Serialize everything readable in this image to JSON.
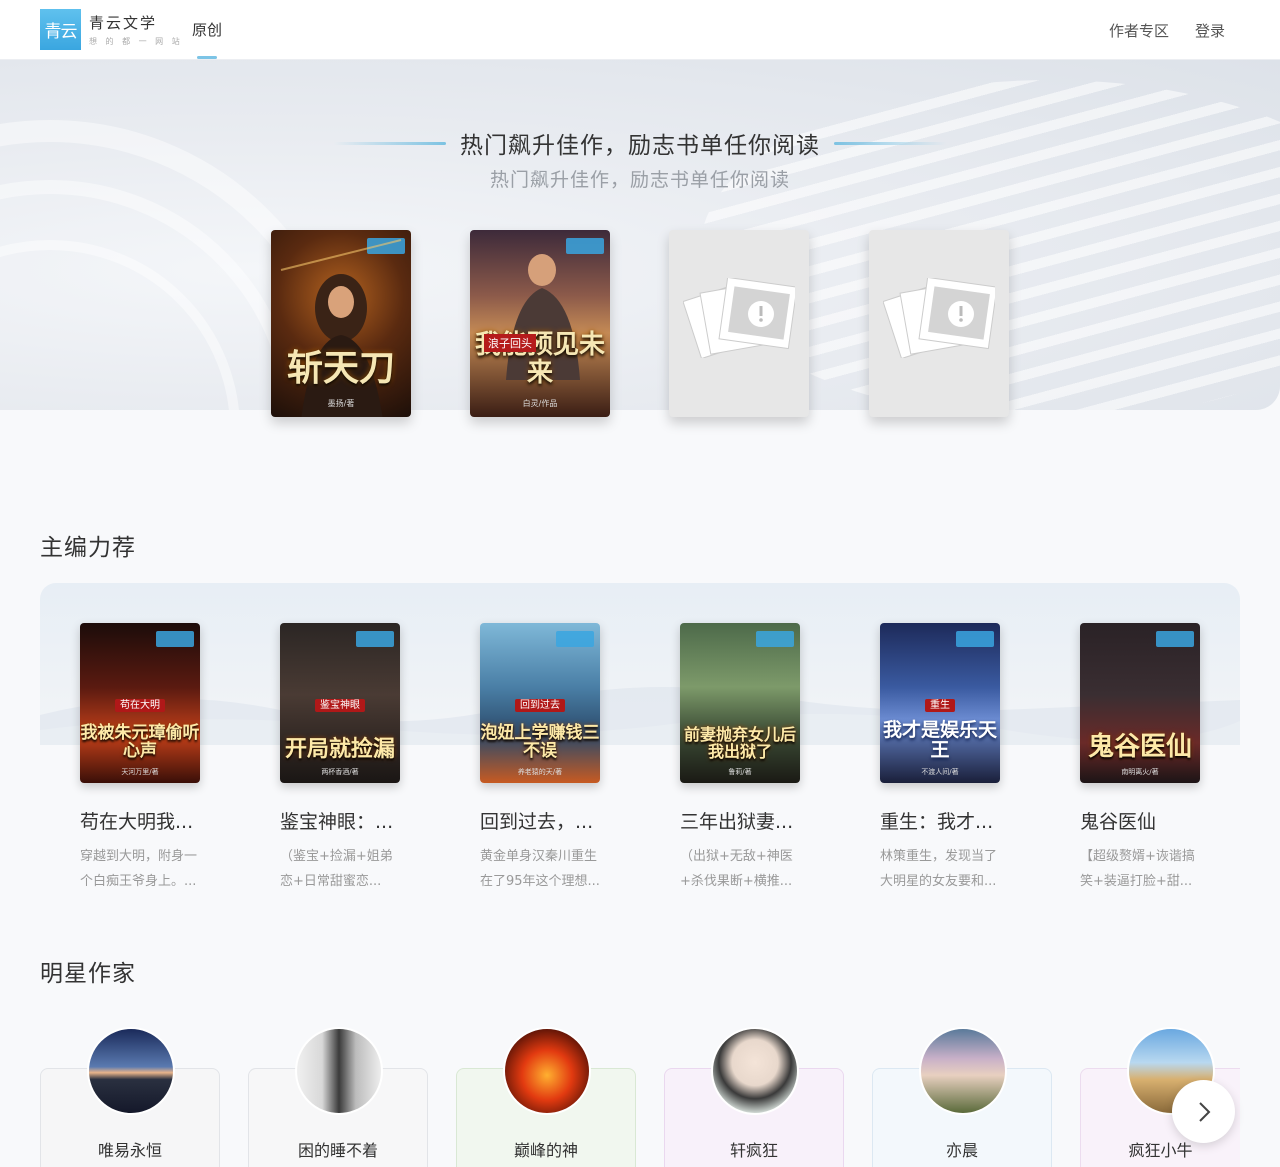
{
  "header": {
    "logo_mark": "青云",
    "logo_name": "青云文学",
    "logo_sub": "想 的 都 一 网 站",
    "nav_original": "原创",
    "author_zone": "作者专区",
    "login": "登录"
  },
  "hero": {
    "title": "热门飙升佳作，励志书单任你阅读",
    "subtitle": "热门飙升佳作，励志书单任你阅读",
    "books": [
      {
        "cover_title": "斩天刀",
        "cover_author": "墨扬/著"
      },
      {
        "cover_badge": "浪子回头",
        "cover_title": "我能预见未来",
        "cover_author": "白灵/作品"
      },
      {
        "cover_title": ""
      },
      {
        "cover_title": ""
      }
    ]
  },
  "picks": {
    "title": "主编力荐",
    "items": [
      {
        "badge": "苟在大明",
        "cover_title": "我被朱元璋偷听心声",
        "cover_author": "天河万里/著",
        "name": "苟在大明我...",
        "desc": "穿越到大明，附身一个白痴王爷身上。..."
      },
      {
        "badge": "鉴宝神眼",
        "cover_title": "开局就捡漏",
        "cover_author": "两杯香酒/著",
        "name": "鉴宝神眼：...",
        "desc": "（鉴宝+捡漏+姐弟恋+日常甜蜜恋..."
      },
      {
        "badge": "回到过去",
        "cover_title": "泡妞上学赚钱三不误",
        "cover_author": "养老猿的天/著",
        "name": "回到过去，...",
        "desc": "黄金单身汉秦川重生在了95年这个理想..."
      },
      {
        "badge": "",
        "cover_title": "前妻抛弃女儿后我出狱了",
        "cover_author": "鲁莉/著",
        "name": "三年出狱妻...",
        "desc": "（出狱+无敌+神医+杀伐果断+横推..."
      },
      {
        "badge": "重生",
        "cover_title": "我才是娱乐天王",
        "cover_author": "不渡人间/著",
        "name": "重生：我才...",
        "desc": "林策重生，发现当了大明星的女友要和..."
      },
      {
        "badge": "",
        "cover_title": "鬼谷医仙",
        "cover_author": "南明离火/著",
        "name": "鬼谷医仙",
        "desc": "【超级赘婿+诙谐搞笑+装逼打脸+甜..."
      }
    ]
  },
  "authors": {
    "title": "明星作家",
    "items": [
      {
        "name": "唯易永恒"
      },
      {
        "name": "困的睡不着"
      },
      {
        "name": "巅峰的神"
      },
      {
        "name": "轩疯狂"
      },
      {
        "name": "亦晨"
      },
      {
        "name": "疯狂小牛"
      }
    ]
  }
}
